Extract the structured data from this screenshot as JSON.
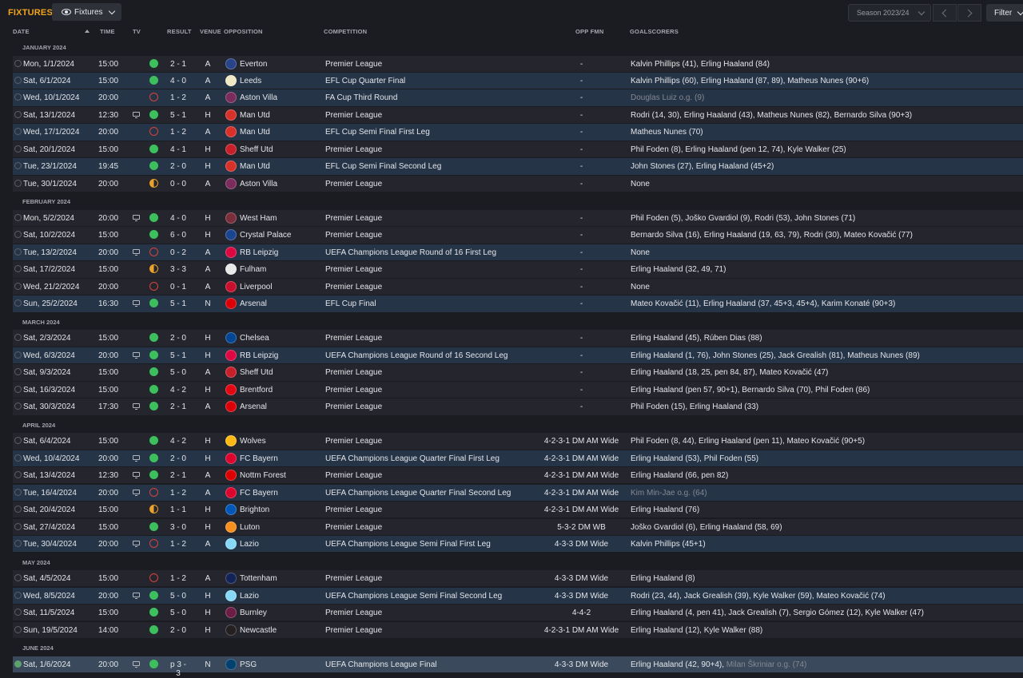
{
  "header": {
    "title": "FIXTURES",
    "view_label": "Fixtures",
    "season_label": "Season 2023/24",
    "filter_label": "Filter"
  },
  "columns": {
    "date": "DATE",
    "time": "TIME",
    "tv": "TV",
    "result": "RESULT",
    "venue": "VENUE",
    "opposition": "OPPOSITION",
    "competition": "COMPETITION",
    "opp_fmn": "OPP FMN",
    "goalscorers": "GOALSCORERS"
  },
  "colors": {
    "accent": "#f2a31c",
    "win": "#3dbf5d",
    "loss": "#d8433d",
    "draw": "#e9a12a",
    "row": "#25262d",
    "row_highlight": "#253447"
  },
  "fixtures": [
    {
      "month": "JANUARY 2024",
      "rows": [
        {
          "date": "Mon, 1/1/2024",
          "time": "15:00",
          "tv": false,
          "result": "win",
          "score": "2 - 1",
          "venue": "A",
          "crest": "#274488",
          "opposition": "Everton",
          "competition": "Premier League",
          "fmn": "-",
          "goals": "Kalvin Phillips (41), Erling Haaland (84)",
          "dim": false,
          "hl": false
        },
        {
          "date": "Sat, 6/1/2024",
          "time": "15:00",
          "tv": false,
          "result": "win",
          "score": "4 - 0",
          "venue": "A",
          "crest": "#f0e7c4",
          "opposition": "Leeds",
          "competition": "EFL Cup Quarter Final",
          "fmn": "-",
          "goals": "Kalvin Phillips (60), Erling Haaland (87, 89), Matheus Nunes (90+6)",
          "dim": false,
          "hl": true
        },
        {
          "date": "Wed, 10/1/2024",
          "time": "20:00",
          "tv": false,
          "result": "loss",
          "score": "1 - 2",
          "venue": "A",
          "crest": "#7a2d5c",
          "opposition": "Aston Villa",
          "competition": "FA Cup Third Round",
          "fmn": "-",
          "goals": "Douglas Luiz o.g. (9)",
          "dim": true,
          "hl": true
        },
        {
          "date": "Sat, 13/1/2024",
          "time": "12:30",
          "tv": true,
          "result": "win",
          "score": "5 - 1",
          "venue": "H",
          "crest": "#d8312a",
          "opposition": "Man Utd",
          "competition": "Premier League",
          "fmn": "-",
          "goals": "Rodri (14, 30), Erling Haaland (43), Matheus Nunes (82), Bernardo Silva (90+3)",
          "dim": false,
          "hl": false
        },
        {
          "date": "Wed, 17/1/2024",
          "time": "20:00",
          "tv": false,
          "result": "loss",
          "score": "1 - 2",
          "venue": "A",
          "crest": "#d8312a",
          "opposition": "Man Utd",
          "competition": "EFL Cup Semi Final First Leg",
          "fmn": "-",
          "goals": "Matheus Nunes (70)",
          "dim": false,
          "hl": true
        },
        {
          "date": "Sat, 20/1/2024",
          "time": "15:00",
          "tv": false,
          "result": "win",
          "score": "4 - 1",
          "venue": "H",
          "crest": "#c8202a",
          "opposition": "Sheff Utd",
          "competition": "Premier League",
          "fmn": "-",
          "goals": "Phil Foden (8), Erling Haaland (pen 12, 74), Kyle Walker (25)",
          "dim": false,
          "hl": false
        },
        {
          "date": "Tue, 23/1/2024",
          "time": "19:45",
          "tv": false,
          "result": "win",
          "score": "2 - 0",
          "venue": "H",
          "crest": "#d8312a",
          "opposition": "Man Utd",
          "competition": "EFL Cup Semi Final Second Leg",
          "fmn": "-",
          "goals": "John Stones (27), Erling Haaland (45+2)",
          "dim": false,
          "hl": true
        },
        {
          "date": "Tue, 30/1/2024",
          "time": "20:00",
          "tv": false,
          "result": "draw",
          "score": "0 - 0",
          "venue": "A",
          "crest": "#7a2d5c",
          "opposition": "Aston Villa",
          "competition": "Premier League",
          "fmn": "-",
          "goals": "None",
          "dim": false,
          "hl": false
        }
      ]
    },
    {
      "month": "FEBRUARY 2024",
      "rows": [
        {
          "date": "Mon, 5/2/2024",
          "time": "20:00",
          "tv": true,
          "result": "win",
          "score": "4 - 0",
          "venue": "H",
          "crest": "#7a2d3a",
          "opposition": "West Ham",
          "competition": "Premier League",
          "fmn": "-",
          "goals": "Phil Foden (5), Joško Gvardiol (9), Rodri (53), John Stones (71)",
          "dim": false,
          "hl": false
        },
        {
          "date": "Sat, 10/2/2024",
          "time": "15:00",
          "tv": false,
          "result": "win",
          "score": "6 - 0",
          "venue": "H",
          "crest": "#1b458f",
          "opposition": "Crystal Palace",
          "competition": "Premier League",
          "fmn": "-",
          "goals": "Bernardo Silva (16), Erling Haaland (19, 63, 79), Rodri (30), Mateo Kovačić (77)",
          "dim": false,
          "hl": false
        },
        {
          "date": "Tue, 13/2/2024",
          "time": "20:00",
          "tv": true,
          "result": "loss",
          "score": "0 - 2",
          "venue": "A",
          "crest": "#dd0741",
          "opposition": "RB Leipzig",
          "competition": "UEFA Champions League Round of 16 First Leg",
          "fmn": "-",
          "goals": "None",
          "dim": false,
          "hl": true
        },
        {
          "date": "Sat, 17/2/2024",
          "time": "15:00",
          "tv": false,
          "result": "draw",
          "score": "3 - 3",
          "venue": "A",
          "crest": "#e8e8e8",
          "opposition": "Fulham",
          "competition": "Premier League",
          "fmn": "-",
          "goals": "Erling Haaland (32, 49, 71)",
          "dim": false,
          "hl": false
        },
        {
          "date": "Wed, 21/2/2024",
          "time": "20:00",
          "tv": false,
          "result": "loss",
          "score": "0 - 1",
          "venue": "A",
          "crest": "#c8102e",
          "opposition": "Liverpool",
          "competition": "Premier League",
          "fmn": "-",
          "goals": "None",
          "dim": false,
          "hl": false
        },
        {
          "date": "Sun, 25/2/2024",
          "time": "16:30",
          "tv": true,
          "result": "win",
          "score": "5 - 1",
          "venue": "N",
          "crest": "#db0007",
          "opposition": "Arsenal",
          "competition": "EFL Cup Final",
          "fmn": "-",
          "goals": "Mateo Kovačić (11), Erling Haaland (37, 45+3, 45+4), Karim Konaté (90+3)",
          "dim": false,
          "hl": true
        }
      ]
    },
    {
      "month": "MARCH 2024",
      "rows": [
        {
          "date": "Sat, 2/3/2024",
          "time": "15:00",
          "tv": false,
          "result": "win",
          "score": "2 - 0",
          "venue": "H",
          "crest": "#034694",
          "opposition": "Chelsea",
          "competition": "Premier League",
          "fmn": "-",
          "goals": "Erling Haaland (45), Rúben Dias (88)",
          "dim": false,
          "hl": false
        },
        {
          "date": "Wed, 6/3/2024",
          "time": "20:00",
          "tv": true,
          "result": "win",
          "score": "5 - 1",
          "venue": "H",
          "crest": "#dd0741",
          "opposition": "RB Leipzig",
          "competition": "UEFA Champions League Round of 16 Second Leg",
          "fmn": "-",
          "goals": "Erling Haaland (1, 76), John Stones (25), Jack Grealish (81), Matheus Nunes (89)",
          "dim": false,
          "hl": true
        },
        {
          "date": "Sat, 9/3/2024",
          "time": "15:00",
          "tv": false,
          "result": "win",
          "score": "5 - 0",
          "venue": "A",
          "crest": "#c8202a",
          "opposition": "Sheff Utd",
          "competition": "Premier League",
          "fmn": "-",
          "goals": "Erling Haaland (18, 25, pen 84, 87), Mateo Kovačić (47)",
          "dim": false,
          "hl": false
        },
        {
          "date": "Sat, 16/3/2024",
          "time": "15:00",
          "tv": false,
          "result": "win",
          "score": "4 - 2",
          "venue": "H",
          "crest": "#e30613",
          "opposition": "Brentford",
          "competition": "Premier League",
          "fmn": "-",
          "goals": "Erling Haaland (pen 57, 90+1), Bernardo Silva (70), Phil Foden (86)",
          "dim": false,
          "hl": false
        },
        {
          "date": "Sat, 30/3/2024",
          "time": "17:30",
          "tv": true,
          "result": "win",
          "score": "2 - 1",
          "venue": "A",
          "crest": "#db0007",
          "opposition": "Arsenal",
          "competition": "Premier League",
          "fmn": "-",
          "goals": "Phil Foden (15), Erling Haaland (33)",
          "dim": false,
          "hl": false
        }
      ]
    },
    {
      "month": "APRIL 2024",
      "rows": [
        {
          "date": "Sat, 6/4/2024",
          "time": "15:00",
          "tv": false,
          "result": "win",
          "score": "4 - 2",
          "venue": "H",
          "crest": "#fdb913",
          "opposition": "Wolves",
          "competition": "Premier League",
          "fmn": "4-2-3-1 DM AM Wide",
          "goals": "Phil Foden (8, 44), Erling Haaland (pen 11), Mateo Kovačić (90+5)",
          "dim": false,
          "hl": false
        },
        {
          "date": "Wed, 10/4/2024",
          "time": "20:00",
          "tv": true,
          "result": "win",
          "score": "2 - 0",
          "venue": "H",
          "crest": "#dc052d",
          "opposition": "FC Bayern",
          "competition": "UEFA Champions League Quarter Final First Leg",
          "fmn": "4-2-3-1 DM AM Wide",
          "goals": "Erling Haaland (53), Phil Foden (55)",
          "dim": false,
          "hl": true
        },
        {
          "date": "Sat, 13/4/2024",
          "time": "12:30",
          "tv": true,
          "result": "win",
          "score": "2 - 1",
          "venue": "A",
          "crest": "#dd0000",
          "opposition": "Nottm Forest",
          "competition": "Premier League",
          "fmn": "4-2-3-1 DM AM Wide",
          "goals": "Erling Haaland (66, pen 82)",
          "dim": false,
          "hl": false
        },
        {
          "date": "Tue, 16/4/2024",
          "time": "20:00",
          "tv": true,
          "result": "loss",
          "score": "1 - 2",
          "venue": "A",
          "crest": "#dc052d",
          "opposition": "FC Bayern",
          "competition": "UEFA Champions League Quarter Final Second Leg",
          "fmn": "4-2-3-1 DM AM Wide",
          "goals": "Kim Min-Jae o.g. (64)",
          "dim": true,
          "hl": true
        },
        {
          "date": "Sat, 20/4/2024",
          "time": "15:00",
          "tv": false,
          "result": "draw",
          "score": "1 - 1",
          "venue": "H",
          "crest": "#0057b8",
          "opposition": "Brighton",
          "competition": "Premier League",
          "fmn": "4-2-3-1 DM AM Wide",
          "goals": "Erling Haaland (76)",
          "dim": false,
          "hl": false
        },
        {
          "date": "Sat, 27/4/2024",
          "time": "15:00",
          "tv": false,
          "result": "win",
          "score": "3 - 0",
          "venue": "H",
          "crest": "#f78f1e",
          "opposition": "Luton",
          "competition": "Premier League",
          "fmn": "5-3-2 DM WB",
          "goals": "Joško Gvardiol (6), Erling Haaland (58, 69)",
          "dim": false,
          "hl": false
        },
        {
          "date": "Tue, 30/4/2024",
          "time": "20:00",
          "tv": true,
          "result": "loss",
          "score": "1 - 2",
          "venue": "A",
          "crest": "#87d8f7",
          "opposition": "Lazio",
          "competition": "UEFA Champions League Semi Final First Leg",
          "fmn": "4-3-3 DM Wide",
          "goals": "Kalvin Phillips (45+1)",
          "dim": false,
          "hl": true
        }
      ]
    },
    {
      "month": "MAY 2024",
      "rows": [
        {
          "date": "Sat, 4/5/2024",
          "time": "15:00",
          "tv": false,
          "result": "loss",
          "score": "1 - 2",
          "venue": "A",
          "crest": "#132257",
          "opposition": "Tottenham",
          "competition": "Premier League",
          "fmn": "4-3-3 DM Wide",
          "goals": "Erling Haaland (8)",
          "dim": false,
          "hl": false
        },
        {
          "date": "Wed, 8/5/2024",
          "time": "20:00",
          "tv": true,
          "result": "win",
          "score": "5 - 0",
          "venue": "H",
          "crest": "#87d8f7",
          "opposition": "Lazio",
          "competition": "UEFA Champions League Semi Final Second Leg",
          "fmn": "4-3-3 DM Wide",
          "goals": "Rodri (23, 44), Jack Grealish (39), Kyle Walker (59), Mateo Kovačić (74)",
          "dim": false,
          "hl": true
        },
        {
          "date": "Sat, 11/5/2024",
          "time": "15:00",
          "tv": false,
          "result": "win",
          "score": "5 - 0",
          "venue": "H",
          "crest": "#6c1d45",
          "opposition": "Burnley",
          "competition": "Premier League",
          "fmn": "4-4-2",
          "goals": "Erling Haaland (4, pen 41), Jack Grealish (7), Sergio Gómez (12), Kyle Walker (47)",
          "dim": false,
          "hl": false
        },
        {
          "date": "Sun, 19/5/2024",
          "time": "14:00",
          "tv": false,
          "result": "win",
          "score": "2 - 0",
          "venue": "H",
          "crest": "#241f20",
          "opposition": "Newcastle",
          "competition": "Premier League",
          "fmn": "4-2-3-1 DM AM Wide",
          "goals": "Erling Haaland (12), Kyle Walker (88)",
          "dim": false,
          "hl": false
        }
      ]
    },
    {
      "month": "JUNE 2024",
      "rows": [
        {
          "date": "Sat, 1/6/2024",
          "time": "20:00",
          "tv": true,
          "result": "win",
          "score": "p 3 - 3",
          "venue": "N",
          "crest": "#004170",
          "opposition": "PSG",
          "competition": "UEFA Champions League Final",
          "fmn": "4-3-3 DM Wide",
          "goals": "Erling Haaland (42, 90+4), ",
          "goals_og": "Milan Škriniar o.g. (74)",
          "dim": false,
          "hl": false,
          "last": true
        }
      ]
    }
  ]
}
